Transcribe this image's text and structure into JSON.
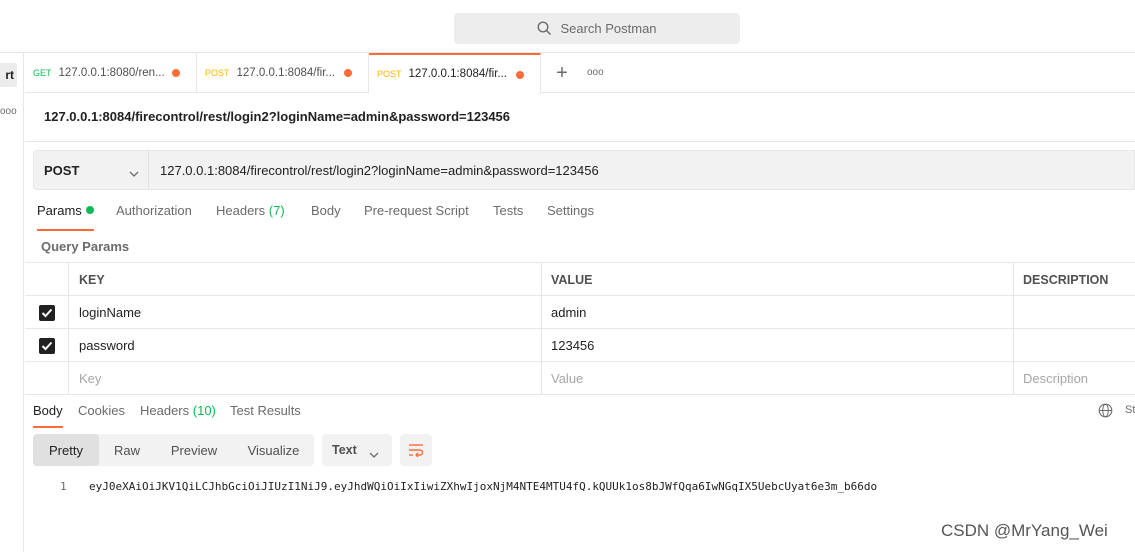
{
  "search": {
    "placeholder": "Search Postman"
  },
  "sidebar": {
    "button_label": "rt",
    "more_label": "ooo"
  },
  "tabs": [
    {
      "method": "GET",
      "url": "127.0.0.1:8080/ren...",
      "active": false
    },
    {
      "method": "POST",
      "url": "127.0.0.1:8084/fir...",
      "active": false
    },
    {
      "method": "POST",
      "url": "127.0.0.1:8084/fir...",
      "active": true
    }
  ],
  "tab_actions": {
    "add": "+",
    "more": "ooo"
  },
  "request": {
    "title": "127.0.0.1:8084/firecontrol/rest/login2?loginName=admin&password=123456",
    "method": "POST",
    "url": "127.0.0.1:8084/firecontrol/rest/login2?loginName=admin&password=123456"
  },
  "request_tabs": {
    "params": "Params",
    "authorization": "Authorization",
    "headers": "Headers",
    "headers_count": "(7)",
    "body": "Body",
    "prerequest": "Pre-request Script",
    "tests": "Tests",
    "settings": "Settings"
  },
  "query_params": {
    "label": "Query Params",
    "headers": {
      "key": "KEY",
      "value": "VALUE",
      "description": "DESCRIPTION"
    },
    "rows": [
      {
        "key": "loginName",
        "value": "admin",
        "description": "",
        "checked": true
      },
      {
        "key": "password",
        "value": "123456",
        "description": "",
        "checked": true
      }
    ],
    "placeholders": {
      "key": "Key",
      "value": "Value",
      "description": "Description"
    }
  },
  "response_tabs": {
    "body": "Body",
    "cookies": "Cookies",
    "headers": "Headers",
    "headers_count": "(10)",
    "test_results": "Test Results",
    "status_partial": "St"
  },
  "view_modes": {
    "pretty": "Pretty",
    "raw": "Raw",
    "preview": "Preview",
    "visualize": "Visualize",
    "format": "Text"
  },
  "response": {
    "line_number": "1",
    "text": "eyJ0eXAiOiJKV1QiLCJhbGciOiJIUzI1NiJ9.eyJhdWQiOiIxIiwiZXhwIjoxNjM4NTE4MTU4fQ.kQUUk1os8bJWfQqa6IwNGqIX5UebcUyat6e3m_b66do"
  },
  "watermark": "CSDN @MrYang_Wei",
  "colors": {
    "accent": "#ff6c37",
    "get": "#0cbb52",
    "post": "#ffb400",
    "green": "#0cbb52"
  }
}
